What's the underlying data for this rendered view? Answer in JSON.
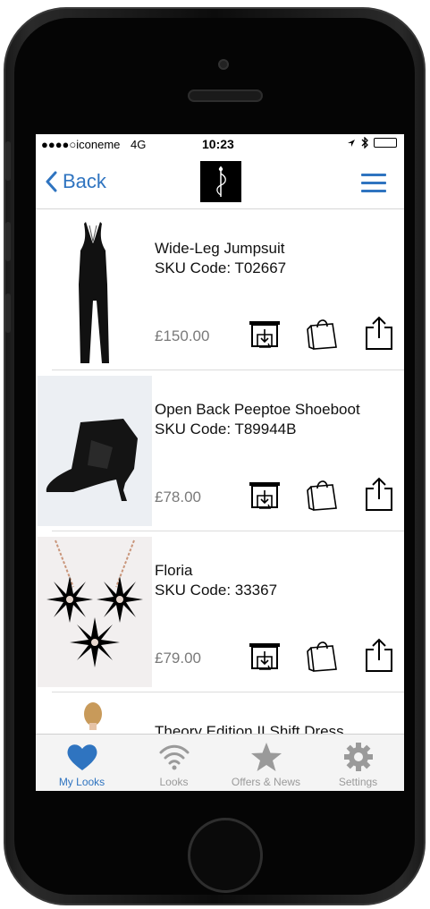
{
  "status": {
    "carrier": "●●●●○iconeme",
    "network": "4G",
    "time": "10:23"
  },
  "nav": {
    "back_label": "Back",
    "logo_icon": "brand-logo-icon",
    "menu_icon": "hamburger-menu-icon"
  },
  "products": [
    {
      "name": "Wide-Leg Jumpsuit",
      "sku": "SKU Code: T02667",
      "price": "£150.00",
      "image": "jumpsuit-image"
    },
    {
      "name": "Open Back Peeptoe Shoeboot",
      "sku": "SKU Code: T89944B",
      "price": "£78.00",
      "image": "shoeboot-image"
    },
    {
      "name": "Floria",
      "sku": "SKU Code: 33367",
      "price": "£79.00",
      "image": "necklace-image"
    },
    {
      "name": "Theory Edition II Shift Dress",
      "sku": "",
      "price": "",
      "image": "dress-image"
    }
  ],
  "row_actions": [
    "store-locator-icon",
    "shopping-bag-icon",
    "share-icon"
  ],
  "tabs": [
    {
      "label": "My Looks",
      "icon": "heart-icon",
      "active": true
    },
    {
      "label": "Looks",
      "icon": "wifi-icon",
      "active": false
    },
    {
      "label": "Offers & News",
      "icon": "star-icon",
      "active": false
    },
    {
      "label": "Settings",
      "icon": "gear-icon",
      "active": false
    }
  ],
  "colors": {
    "accent": "#2f74c0",
    "price": "#7a7a7a",
    "tab_inactive": "#9a9a9a"
  }
}
